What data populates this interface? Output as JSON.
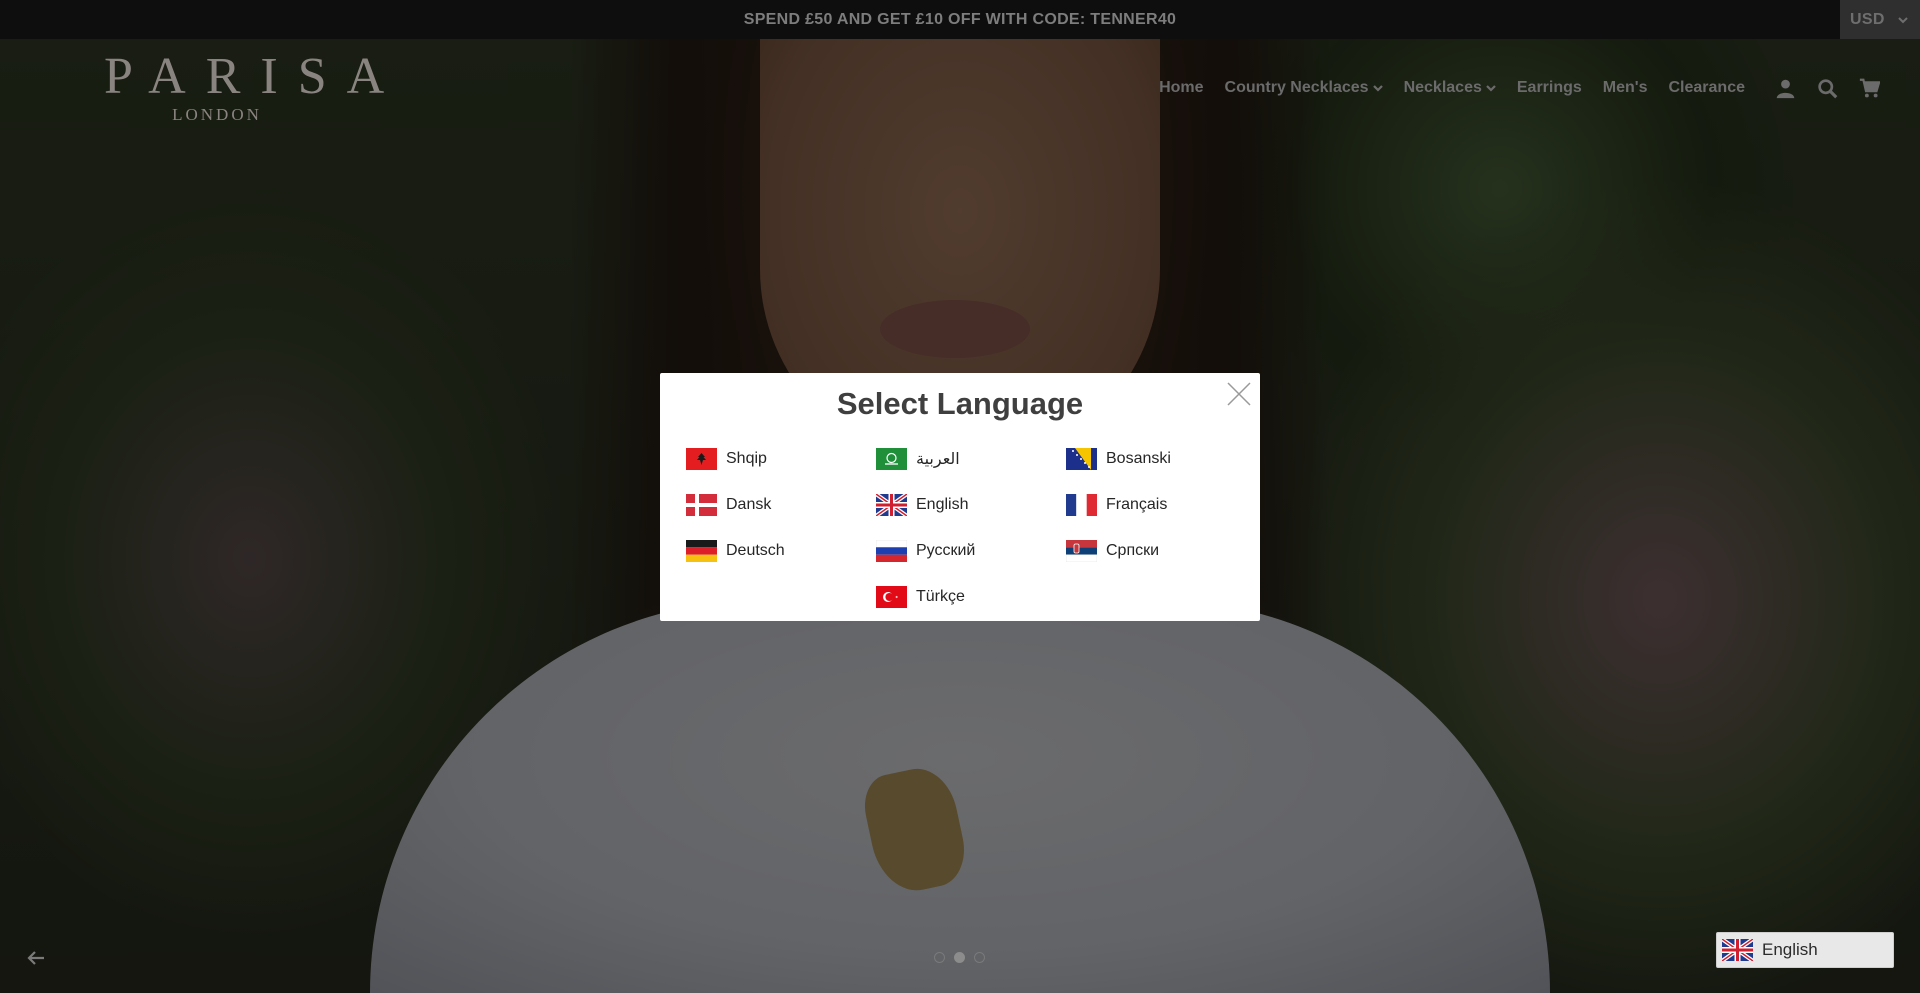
{
  "announcement": {
    "text": "SPEND £50 AND GET £10 OFF WITH CODE: TENNER40"
  },
  "currency": {
    "selected": "USD"
  },
  "logo": {
    "brand": "PARISA",
    "sub": "LONDON"
  },
  "nav": {
    "items": [
      {
        "label": "Home",
        "dropdown": false
      },
      {
        "label": "Country Necklaces",
        "dropdown": true
      },
      {
        "label": "Necklaces",
        "dropdown": true
      },
      {
        "label": "Earrings",
        "dropdown": false
      },
      {
        "label": "Men's",
        "dropdown": false
      },
      {
        "label": "Clearance",
        "dropdown": false
      }
    ],
    "icons": [
      "account-icon",
      "search-icon",
      "cart-icon"
    ]
  },
  "modal": {
    "title": "Select Language",
    "languages": [
      {
        "label": "Shqip",
        "flag": "albania-flag-icon"
      },
      {
        "label": "العربية",
        "flag": "saudi-arabia-flag-icon"
      },
      {
        "label": "Bosanski",
        "flag": "bosnia-flag-icon"
      },
      {
        "label": "Dansk",
        "flag": "denmark-flag-icon"
      },
      {
        "label": "English",
        "flag": "uk-flag-icon"
      },
      {
        "label": "Français",
        "flag": "france-flag-icon"
      },
      {
        "label": "Deutsch",
        "flag": "germany-flag-icon"
      },
      {
        "label": "Русский",
        "flag": "russia-flag-icon"
      },
      {
        "label": "Српски",
        "flag": "serbia-flag-icon"
      },
      {
        "label": "Türkçe",
        "flag": "turkey-flag-icon"
      }
    ]
  },
  "slider": {
    "dot_count": 3,
    "active_dot": 2
  },
  "language_switcher": {
    "label": "English",
    "flag": "uk-flag-icon"
  },
  "colors": {
    "announcement_bg": "#0e0e0e",
    "modal_bg": "#ffffff",
    "overlay": "rgba(0,0,0,0.56)"
  }
}
